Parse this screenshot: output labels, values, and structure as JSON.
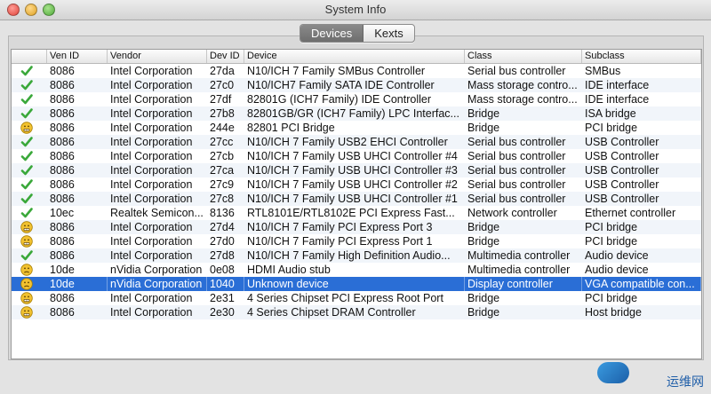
{
  "window": {
    "title": "System Info"
  },
  "tabs": [
    {
      "label": "Devices",
      "active": true
    },
    {
      "label": "Kexts",
      "active": false
    }
  ],
  "table": {
    "headers": [
      "Ven ID",
      "Vendor",
      "Dev ID",
      "Device",
      "Class",
      "Subclass"
    ],
    "rows": [
      {
        "status": "ok",
        "ven_id": "8086",
        "vendor": "Intel Corporation",
        "dev_id": "27da",
        "device": "N10/ICH 7 Family SMBus Controller",
        "class": "Serial bus controller",
        "subclass": "SMBus"
      },
      {
        "status": "ok",
        "ven_id": "8086",
        "vendor": "Intel Corporation",
        "dev_id": "27c0",
        "device": "N10/ICH7 Family SATA IDE Controller",
        "class": "Mass storage contro...",
        "subclass": "IDE interface"
      },
      {
        "status": "ok",
        "ven_id": "8086",
        "vendor": "Intel Corporation",
        "dev_id": "27df",
        "device": "82801G (ICH7 Family) IDE Controller",
        "class": "Mass storage contro...",
        "subclass": "IDE interface"
      },
      {
        "status": "ok",
        "ven_id": "8086",
        "vendor": "Intel Corporation",
        "dev_id": "27b8",
        "device": "82801GB/GR (ICH7 Family) LPC Interfac...",
        "class": "Bridge",
        "subclass": "ISA bridge"
      },
      {
        "status": "warn",
        "ven_id": "8086",
        "vendor": "Intel Corporation",
        "dev_id": "244e",
        "device": "82801 PCI Bridge",
        "class": "Bridge",
        "subclass": "PCI bridge"
      },
      {
        "status": "ok",
        "ven_id": "8086",
        "vendor": "Intel Corporation",
        "dev_id": "27cc",
        "device": "N10/ICH 7 Family USB2 EHCI Controller",
        "class": "Serial bus controller",
        "subclass": "USB Controller"
      },
      {
        "status": "ok",
        "ven_id": "8086",
        "vendor": "Intel Corporation",
        "dev_id": "27cb",
        "device": "N10/ICH 7 Family USB UHCI Controller #4",
        "class": "Serial bus controller",
        "subclass": "USB Controller"
      },
      {
        "status": "ok",
        "ven_id": "8086",
        "vendor": "Intel Corporation",
        "dev_id": "27ca",
        "device": "N10/ICH 7 Family USB UHCI Controller #3",
        "class": "Serial bus controller",
        "subclass": "USB Controller"
      },
      {
        "status": "ok",
        "ven_id": "8086",
        "vendor": "Intel Corporation",
        "dev_id": "27c9",
        "device": "N10/ICH 7 Family USB UHCI Controller #2",
        "class": "Serial bus controller",
        "subclass": "USB Controller"
      },
      {
        "status": "ok",
        "ven_id": "8086",
        "vendor": "Intel Corporation",
        "dev_id": "27c8",
        "device": "N10/ICH 7 Family USB UHCI Controller #1",
        "class": "Serial bus controller",
        "subclass": "USB Controller"
      },
      {
        "status": "ok",
        "ven_id": "10ec",
        "vendor": "Realtek Semicon...",
        "dev_id": "8136",
        "device": "RTL8101E/RTL8102E PCI Express Fast...",
        "class": "Network controller",
        "subclass": "Ethernet controller"
      },
      {
        "status": "warn",
        "ven_id": "8086",
        "vendor": "Intel Corporation",
        "dev_id": "27d4",
        "device": "N10/ICH 7 Family PCI Express Port 3",
        "class": "Bridge",
        "subclass": "PCI bridge"
      },
      {
        "status": "warn",
        "ven_id": "8086",
        "vendor": "Intel Corporation",
        "dev_id": "27d0",
        "device": "N10/ICH 7 Family PCI Express Port 1",
        "class": "Bridge",
        "subclass": "PCI bridge"
      },
      {
        "status": "ok",
        "ven_id": "8086",
        "vendor": "Intel Corporation",
        "dev_id": "27d8",
        "device": "N10/ICH 7 Family High Definition Audio...",
        "class": "Multimedia controller",
        "subclass": "Audio device"
      },
      {
        "status": "sad",
        "ven_id": "10de",
        "vendor": "nVidia Corporation",
        "dev_id": "0e08",
        "device": "HDMI Audio stub",
        "class": "Multimedia controller",
        "subclass": "Audio device"
      },
      {
        "status": "sad",
        "ven_id": "10de",
        "vendor": "nVidia Corporation",
        "dev_id": "1040",
        "device": "Unknown device",
        "class": "Display controller",
        "subclass": "VGA compatible con...",
        "selected": true
      },
      {
        "status": "warn",
        "ven_id": "8086",
        "vendor": "Intel Corporation",
        "dev_id": "2e31",
        "device": "4 Series Chipset PCI Express Root Port",
        "class": "Bridge",
        "subclass": "PCI bridge"
      },
      {
        "status": "warn",
        "ven_id": "8086",
        "vendor": "Intel Corporation",
        "dev_id": "2e30",
        "device": "4 Series Chipset DRAM Controller",
        "class": "Bridge",
        "subclass": "Host bridge"
      }
    ]
  },
  "icons": {
    "ok": "green-checkmark-icon",
    "warn": "grimace-face-icon",
    "sad": "frown-face-icon"
  },
  "colors": {
    "selection": "#2a6ed6",
    "ok": "#3aa83a",
    "face": "#f2c230"
  },
  "watermark": {
    "text": "运维网"
  }
}
